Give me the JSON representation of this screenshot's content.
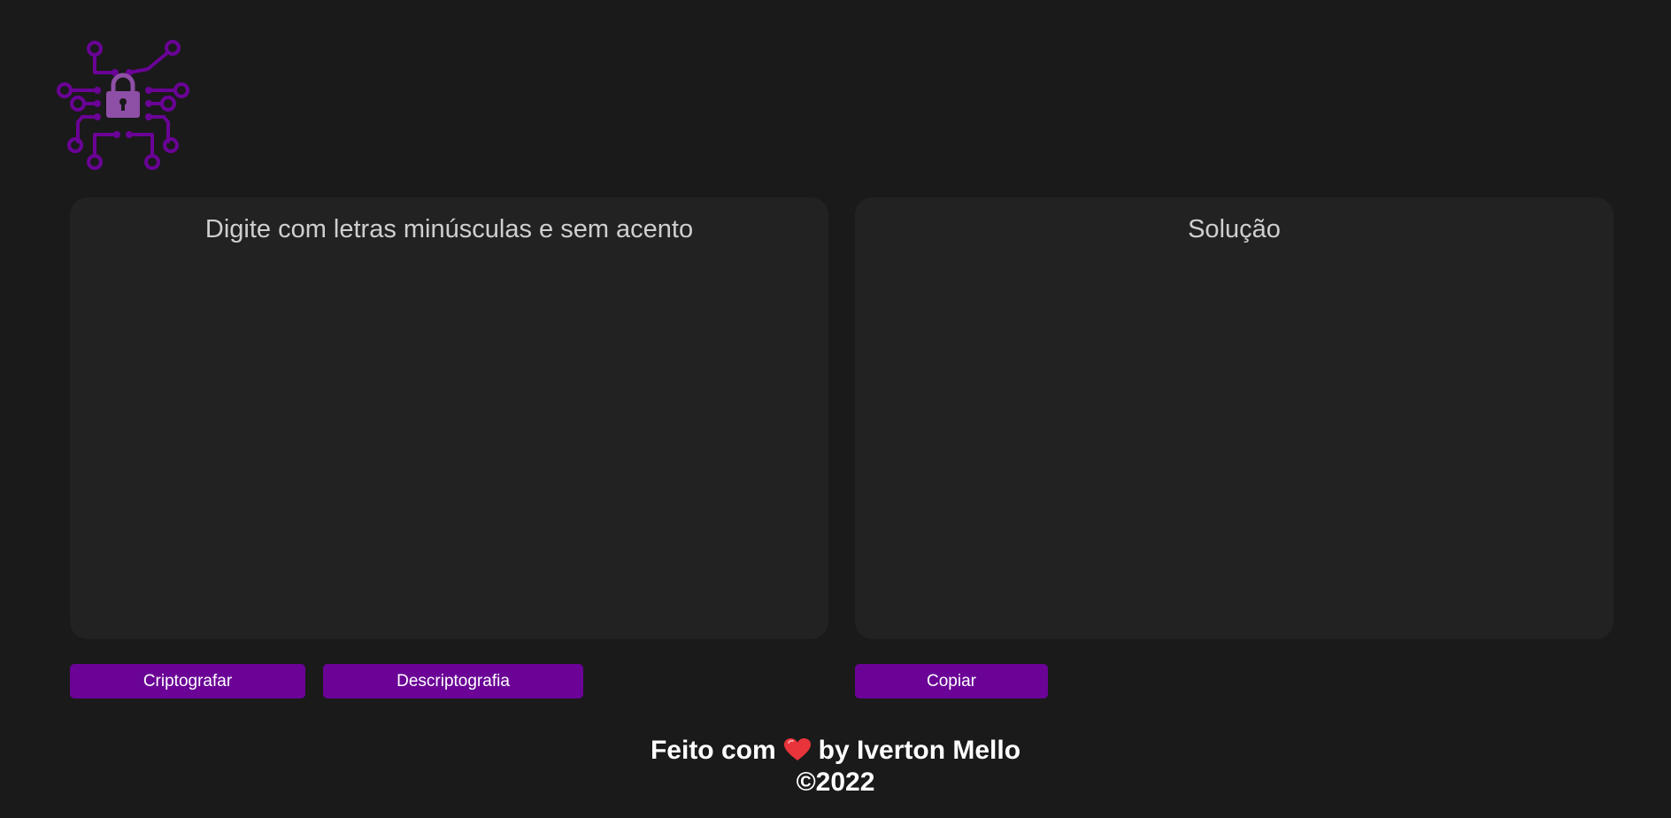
{
  "logo": {
    "icon": "circuit-lock-icon",
    "color": "#6a0396"
  },
  "input_panel": {
    "placeholder": "Digite com letras minúsculas e sem acento"
  },
  "output_panel": {
    "title": "Solução"
  },
  "buttons": {
    "encrypt_label": "Criptografar",
    "decrypt_label": "Descriptografia",
    "copy_label": "Copiar"
  },
  "footer": {
    "prefix": "Feito com",
    "heart_icon": "heart-icon",
    "suffix": "by Iverton Mello",
    "copyright": "©2022"
  },
  "colors": {
    "background": "#1a1a1a",
    "panel": "#222222",
    "accent": "#6a0396",
    "heart": "#e8343a"
  }
}
